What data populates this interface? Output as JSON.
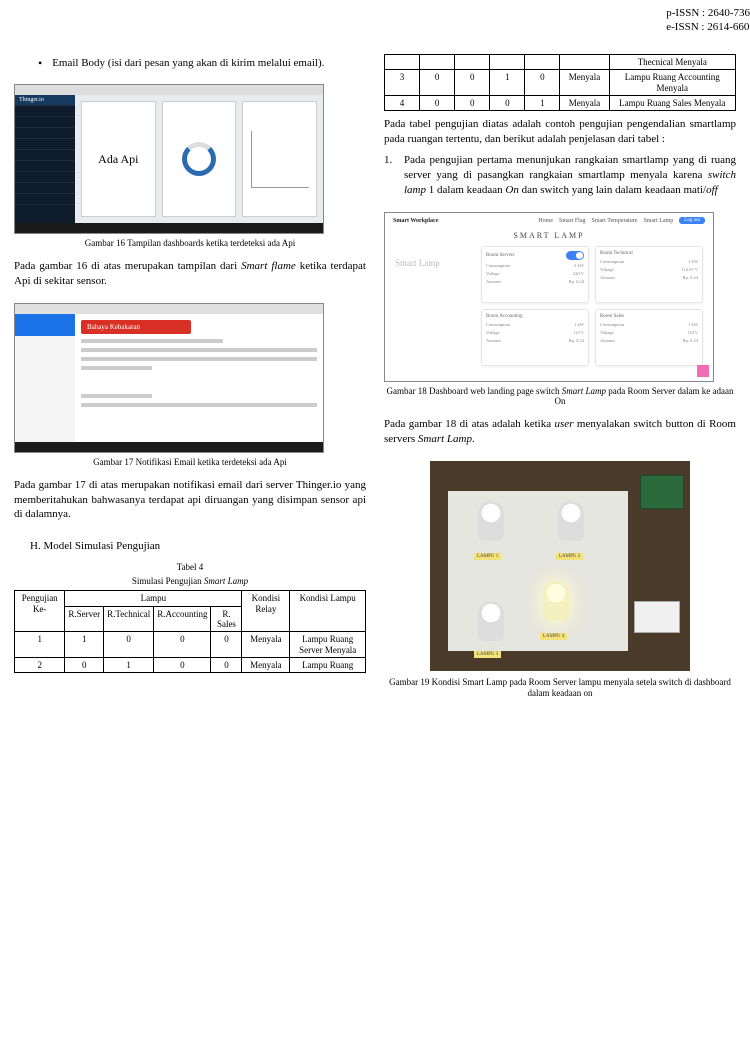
{
  "issn": {
    "p": "p-ISSN : 2640-736",
    "e": "e-ISSN : 2614-660"
  },
  "left": {
    "bullet": "Email Body (isi dari pesan yang akan di kirim melalui email).",
    "fig16": {
      "caption": "Gambar 16 Tampilan dashboards ketika terdeteksi ada Api",
      "brand": "Thinger.io",
      "panel_main": "Ada Api"
    },
    "para16": "Pada gambar 16 di atas merupakan tampilan dari Smart flame ketika terdapat Api di sekitar sensor.",
    "fig17": {
      "caption": "Gambar 17 Notifikasi Email ketika terdeteksi ada Api",
      "subject": "Bahaya Kebakaran"
    },
    "para17": "Pada gambar 17 di atas merupakan notifikasi email dari server Thinger.io yang memberitahukan bahwasanya terdapat api diruangan yang disimpan sensor api di dalamnya.",
    "sectionH": "H.   Model Simulasi Pengujian",
    "tbl4": {
      "num": "Tabel 4",
      "title": "Simulasi Pengujian Smart Lamp",
      "headers": {
        "pengujian": "Pengujian Ke-",
        "lampu": "Lampu",
        "r_server": "R.Server",
        "r_tech": "R.Technical",
        "r_accou": "R.Accounting",
        "r_sales": "R. Sales",
        "relay": "Kondisi Relay",
        "kondisi": "Kondisi Lampu"
      },
      "rows": [
        {
          "n": "1",
          "a": "1",
          "b": "0",
          "c": "0",
          "d": "0",
          "relay": "Menyala",
          "kondisi": "Lampu Ruang Server Menyala"
        },
        {
          "n": "2",
          "a": "0",
          "b": "1",
          "c": "0",
          "d": "0",
          "relay": "Menyala",
          "kondisi": "Lampu Ruang"
        }
      ]
    }
  },
  "right": {
    "tbl_cont": {
      "r0_tail": "Thecnical Menyala",
      "rows": [
        {
          "n": "3",
          "a": "0",
          "b": "0",
          "c": "1",
          "d": "0",
          "relay": "Menyala",
          "kondisi": "Lampu Ruang Accounting Menyala"
        },
        {
          "n": "4",
          "a": "0",
          "b": "0",
          "c": "0",
          "d": "1",
          "relay": "Menyala",
          "kondisi": "Lampu Ruang Sales Menyala"
        }
      ]
    },
    "para_intro": "Pada tabel pengujian diatas adalah contoh pengujian pengendalian smartlamp pada ruangan tertentu, dan berikut adalah penjelasan dari tabel :",
    "item1": "Pada pengujian pertama menunjukan rangkaian smartlamp yang di ruang server yang di pasangkan rangkaian smartlamp menyala karena switch lamp 1 dalam keadaan On dan switch yang lain dalam keadaan mati/off",
    "fig18": {
      "brand": "Smart Workplace",
      "nav": {
        "a": "Home",
        "b": "Smart Flag",
        "c": "Smart Temperature",
        "d": "Smart Lamp",
        "btn": "Log out"
      },
      "banner": "SMART LAMP",
      "leftlabel": "Smart Lamp",
      "card1": "Room Servers",
      "card2": "Room Technical",
      "card3": "Room Accounting",
      "card4": "Room Sales",
      "caption": "Gambar 18 Dashboard web landing page switch Smart Lamp pada Room Server dalam ke adaan On"
    },
    "para18": "Pada gambar 18 di atas adalah ketika user  menyalakan switch button di Room servers Smart Lamp.",
    "fig19": {
      "caption": "Gambar 19 Kondisi Smart Lamp pada Room Server lampu menyala setela switch di dashboard dalam keadaan on"
    }
  }
}
